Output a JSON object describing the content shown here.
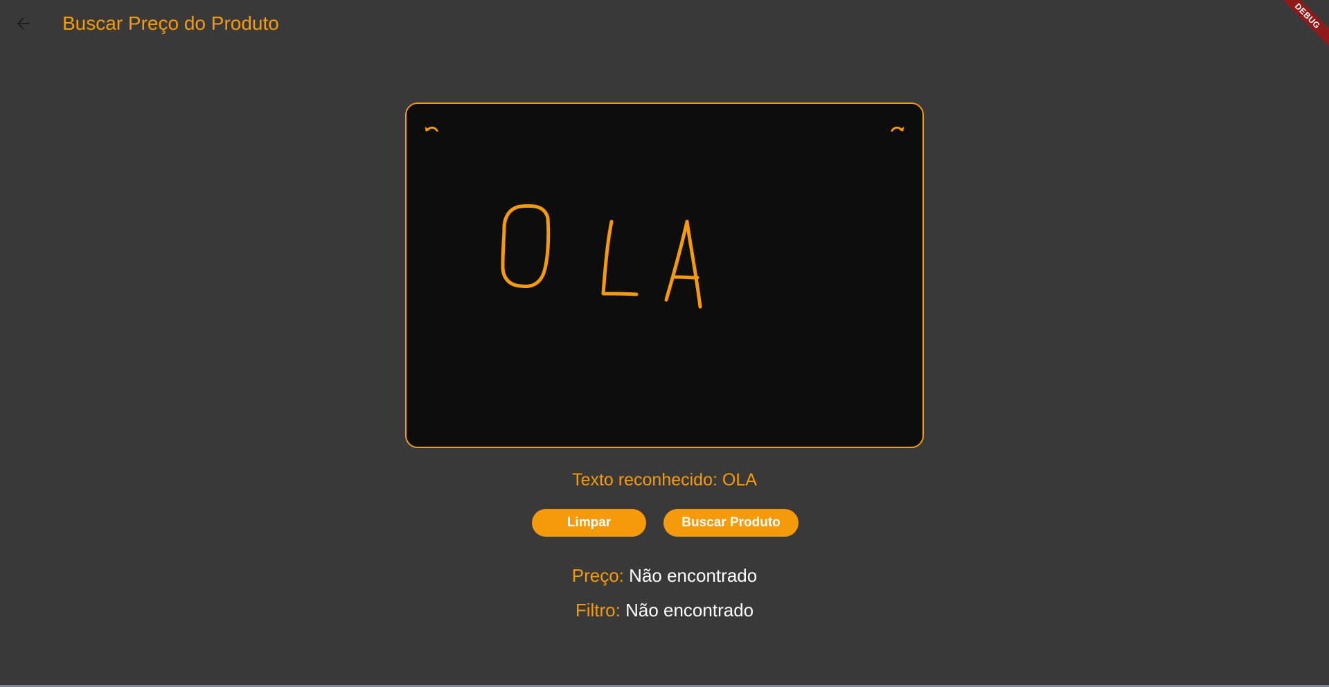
{
  "theme": {
    "accent": "#f59a0b",
    "background": "#393939",
    "canvas_background": "#0e0d0e",
    "text_light": "#ffffff",
    "icon_dark": "#1c1c1c",
    "debug_banner": "#8e1a1a"
  },
  "appbar": {
    "back_icon": "arrow-left-icon",
    "title": "Buscar Preço do Produto"
  },
  "debug_banner": {
    "label": "DEBUG"
  },
  "canvas": {
    "undo_icon": "undo-icon",
    "redo_icon": "redo-icon",
    "drawn_letters": "OLA"
  },
  "recognized": {
    "text": "Texto reconhecido: OLA"
  },
  "buttons": {
    "clear_label": "Limpar",
    "search_label": "Buscar Produto"
  },
  "results": {
    "price_label": "Preço:",
    "price_value": "Não encontrado",
    "filter_label": "Filtro:",
    "filter_value": "Não encontrado"
  }
}
